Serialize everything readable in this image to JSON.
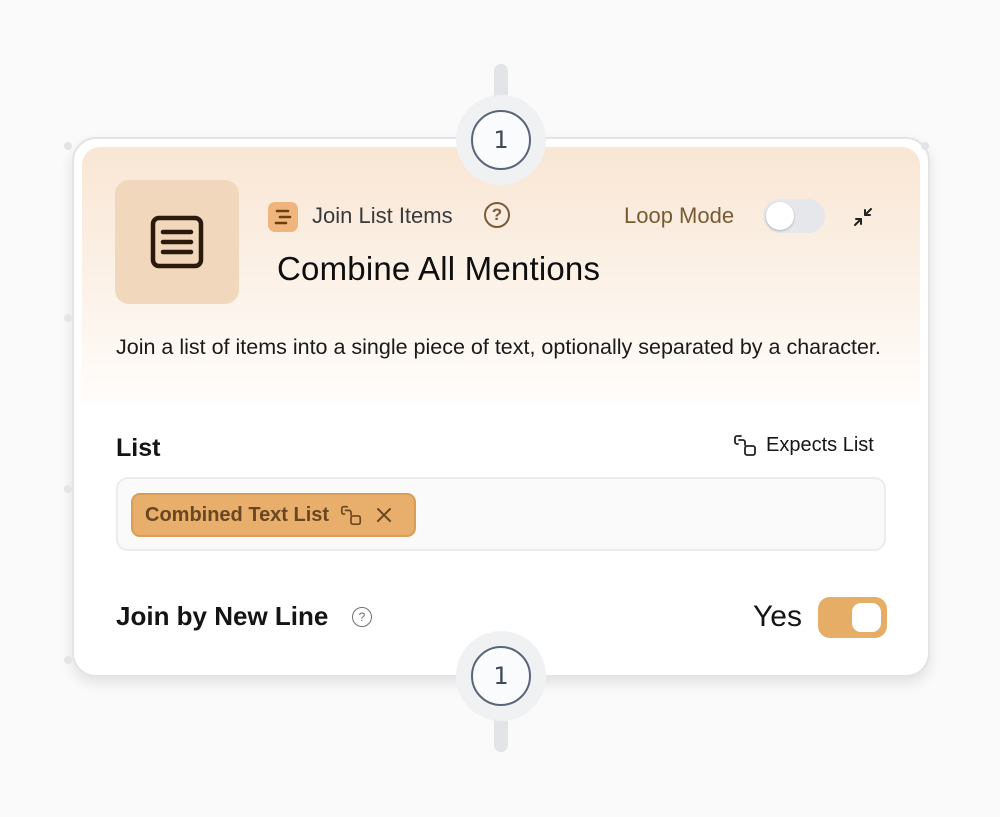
{
  "node": {
    "step_top": "1",
    "step_bottom": "1",
    "type_label": "Join List Items",
    "title": "Combine All Mentions",
    "description": "Join a list of items into a single piece of text, optionally separated by a character.",
    "loop_mode_label": "Loop Mode",
    "loop_mode_enabled": false,
    "icons": {
      "node_icon": "text-lines-icon",
      "type_icon": "list-icon",
      "help": "help-circle-icon",
      "collapse": "collapse-icon"
    }
  },
  "fields": {
    "list": {
      "label": "List",
      "expects_label": "Expects List",
      "chip_label": "Combined Text List"
    },
    "join_new_line": {
      "label": "Join by New Line",
      "value_label": "Yes",
      "enabled": true
    }
  },
  "colors": {
    "accent": "#e5ad66",
    "header_bg": "#f9e6d4",
    "tile_bg": "#f1d8bd"
  }
}
